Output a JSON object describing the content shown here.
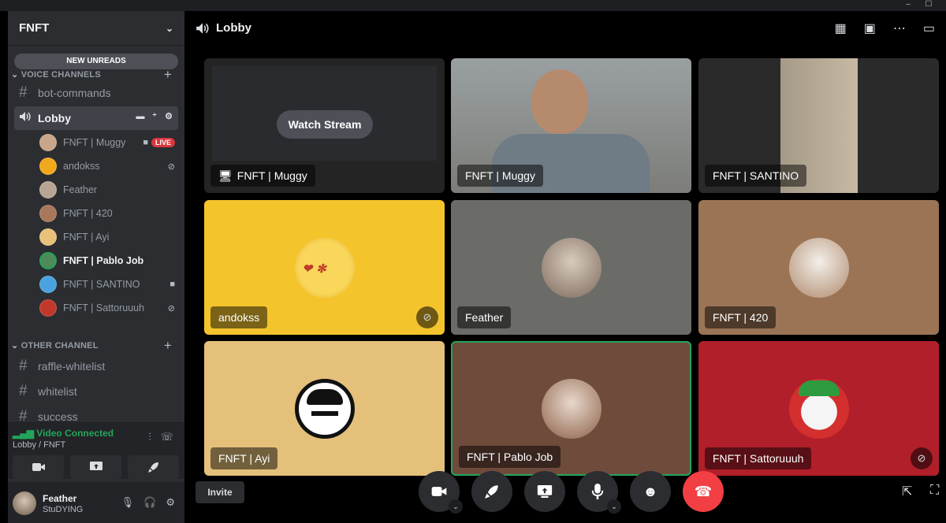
{
  "window": {
    "minimize": "–",
    "maximize": "☐"
  },
  "server": {
    "name": "FNFT",
    "new_unreads": "NEW UNREADS"
  },
  "categories": {
    "voice": "VOICE CHANNELS",
    "other": "OTHER CHANNEL"
  },
  "channels": {
    "bot_commands": "bot-commands",
    "lobby": "Lobby",
    "raffle_whitelist": "raffle-whitelist",
    "whitelist": "whitelist",
    "success": "success"
  },
  "voice_users": [
    {
      "name": "FNFT | Muggy",
      "badge": "LIVE",
      "color": "#c9a58a"
    },
    {
      "name": "andokss",
      "color": "#f2a81d"
    },
    {
      "name": "Feather",
      "color": "#b9a594"
    },
    {
      "name": "FNFT | 420",
      "color": "#a9785a"
    },
    {
      "name": "FNFT | Ayi",
      "color": "#e8c27a"
    },
    {
      "name": "FNFT | Pablo Job",
      "color": "#4f8a5a"
    },
    {
      "name": "FNFT | SANTINO",
      "color": "#4aa3df"
    },
    {
      "name": "FNFT | Sattoruuuh",
      "color": "#c0392b"
    }
  ],
  "voice_connection": {
    "status": "Video Connected",
    "location": "Lobby / FNFT"
  },
  "user": {
    "name": "Feather",
    "status": "StuDYING"
  },
  "header": {
    "channel": "Lobby"
  },
  "tiles": [
    {
      "name": "FNFT | Muggy",
      "watch": "Watch Stream",
      "bg": "#242424"
    },
    {
      "name": "FNFT | Muggy",
      "bg": "#8e8f8c"
    },
    {
      "name": "FNFT | SANTINO",
      "bg": "#2a2a2a"
    },
    {
      "name": "andokss",
      "bg": "#f4c42c"
    },
    {
      "name": "Feather",
      "bg": "#6b6b68"
    },
    {
      "name": "FNFT | 420",
      "bg": "#9b7455"
    },
    {
      "name": "FNFT | Ayi",
      "bg": "#e4c07b"
    },
    {
      "name": "FNFT | Pablo Job",
      "bg": "#6f4b3c"
    },
    {
      "name": "FNFT | Sattoruuuh",
      "bg": "#b11f2a"
    }
  ],
  "controls": {
    "invite": "Invite"
  },
  "colors": {
    "accent_green": "#23a55a",
    "danger": "#f23f43",
    "speaking": "#23a55a"
  },
  "icons": {
    "speaker": "speaker-icon",
    "hash": "hash-icon",
    "camera": "camera-icon",
    "screen": "screen-share-icon",
    "rocket": "rocket-icon",
    "mic": "microphone-icon",
    "headphones": "headphones-icon",
    "settings": "gear-icon",
    "emoji": "emoji-icon",
    "leave": "leave-call-icon"
  }
}
